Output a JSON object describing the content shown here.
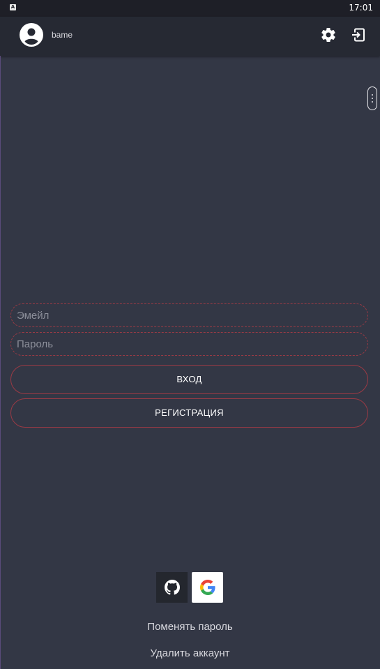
{
  "status_bar": {
    "app_icon": "A",
    "time": "17:01"
  },
  "top_bar": {
    "username": "bame",
    "icons": {
      "avatar": "account-circle-icon",
      "settings": "gear-icon",
      "logout": "logout-icon"
    }
  },
  "form": {
    "email_placeholder": "Эмейл",
    "email_value": "",
    "password_placeholder": "Пароль",
    "password_value": "",
    "login_label": "ВХОД",
    "register_label": "РЕГИСТРАЦИЯ"
  },
  "social": {
    "icons": [
      "github-icon",
      "google-icon"
    ]
  },
  "links": {
    "change_password": "Поменять пароль",
    "delete_account": "Удалить аккаунт"
  },
  "colors": {
    "background": "#333745",
    "topbar": "#262933",
    "accent_border": "#9b3a45"
  }
}
